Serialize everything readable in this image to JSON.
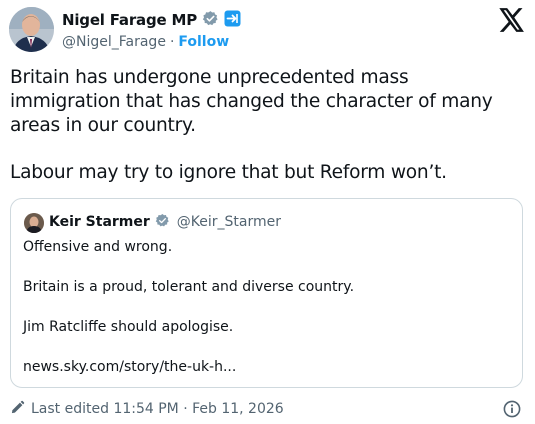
{
  "author": {
    "name": "Nigel Farage MP",
    "handle": "@Nigel_Farage",
    "separator": "·",
    "follow_label": "Follow"
  },
  "tweet": {
    "paragraphs": [
      "Britain has undergone unprecedented mass immigration that has changed the character of many areas in our country.",
      "Labour may try to ignore that but Reform won’t."
    ]
  },
  "quoted_tweet": {
    "name": "Keir Starmer",
    "handle": "@Keir_Starmer",
    "lines": [
      "Offensive and wrong.",
      "Britain is a proud, tolerant and diverse country.",
      "Jim Ratcliffe should apologise.",
      "news.sky.com/story/the-uk-h..."
    ]
  },
  "footer": {
    "edited_text": "Last edited 11:54 PM · Feb 11, 2026"
  },
  "colors": {
    "text": "#0f1419",
    "secondary": "#536471",
    "link": "#1d9bf0",
    "border": "#cfd9de",
    "verified_badge": "#829aab",
    "automated_badge": "#1d9bf0"
  },
  "icons": [
    "avatar",
    "verified-badge-icon",
    "automated-account-icon",
    "x-logo-icon",
    "pencil-icon",
    "info-icon"
  ]
}
